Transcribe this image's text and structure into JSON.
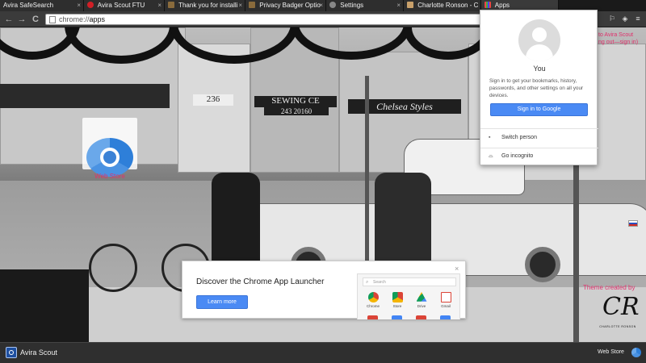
{
  "tabs": [
    {
      "label": "Avira SafeSearch",
      "icon": "avira-icon"
    },
    {
      "label": "Avira Scout FTU",
      "icon": "avira-icon"
    },
    {
      "label": "Thank you for installi",
      "icon": "badger-icon"
    },
    {
      "label": "Privacy Badger Optio",
      "icon": "badger-icon"
    },
    {
      "label": "Settings",
      "icon": "gear-icon"
    },
    {
      "label": "Charlotte Ronson - C",
      "icon": "page-icon"
    },
    {
      "label": "Apps",
      "icon": "apps-grid-icon"
    }
  ],
  "toolbar": {
    "back": "←",
    "forward": "→",
    "reload": "C",
    "url_scheme": "chrome://",
    "url_host": "apps"
  },
  "apps": [
    {
      "label": "Web Store"
    }
  ],
  "profile_popup": {
    "name": "You",
    "description": "Sign in to get your bookmarks, history, passwords, and other settings on all your devices.",
    "sign_in_button": "Sign in to Google",
    "switch_person": "Switch person",
    "go_incognito": "Go incognito"
  },
  "side_text": {
    "sign_in_line1": "to Avira Scout",
    "sign_in_line2": "ng out—sign in)",
    "theme_created": "Theme created by"
  },
  "promo": {
    "title": "Discover the Chrome App Launcher",
    "learn_more": "Learn more",
    "close": "×",
    "launcher_search": "Search",
    "launcher_apps": [
      "Chrome",
      "Store",
      "Drive",
      "Gmail"
    ]
  },
  "signature": {
    "mark": "CR",
    "text": "CHARLOTTE RONSON"
  },
  "bottombar": {
    "app_name": "Avira Scout",
    "web_store": "Web Store"
  },
  "store_signs": {
    "sewing": "SEWING CE",
    "phone": "243 20160",
    "chelsea": "Chelsea Styles",
    "number": "236"
  },
  "colors": {
    "accent_blue": "#4a8af4",
    "theme_pink": "#e1306c"
  }
}
